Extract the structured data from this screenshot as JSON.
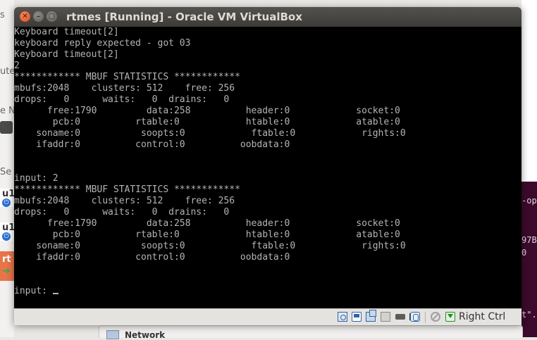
{
  "window": {
    "title": "rtmes [Running] - Oracle VM VirtualBox",
    "close_glyph": "✕",
    "minimize_glyph": "–",
    "maximize_glyph": "□"
  },
  "console": {
    "lines": [
      "Keyboard timeout[2]",
      "keyboard reply expected - got 03",
      "Keyboard timeout[2]",
      "2",
      "************ MBUF STATISTICS ************",
      "mbufs:2048    clusters: 512    free: 256",
      "drops:   0      waits:   0  drains:   0",
      "      free:1790         data:258          header:0            socket:0",
      "       pcb:0          rtable:0            htable:0            atable:0",
      "    soname:0           soopts:0            ftable:0            rights:0",
      "    ifaddr:0          control:0          oobdata:0",
      "",
      "",
      "input: 2",
      "************ MBUF STATISTICS ************",
      "mbufs:2048    clusters: 512    free: 256",
      "drops:   0      waits:   0  drains:   0",
      "      free:1790         data:258          header:0            socket:0",
      "       pcb:0          rtable:0            htable:0            atable:0",
      "    soname:0           soopts:0            ftable:0            rights:0",
      "    ifaddr:0          control:0          oobdata:0",
      "",
      "",
      "input: "
    ]
  },
  "statusbar": {
    "host_key": "Right Ctrl",
    "icons": [
      "hard-disk-icon",
      "optical-drive-icon",
      "network-icon",
      "shared-folders-icon",
      "usb-icon",
      "video-capture-icon",
      "mouse-integration-icon",
      "no-entry-icon",
      "host-key-arrow-icon"
    ]
  },
  "background": {
    "left_fragments": [
      "s",
      "ute",
      "e N",
      "Se",
      "u1",
      "u1",
      "rt"
    ],
    "right_fragments": [
      "-op",
      "97B",
      "0",
      "t\"."
    ],
    "bottom_panel_label": "Network"
  },
  "colors": {
    "console_bg": "#000000",
    "console_text": "#b4b4b4",
    "title_bg": "#3c3b37",
    "close_button": "#df4a16",
    "selected_row": "#e8744a",
    "terminal_bg": "#3c0a2c"
  }
}
